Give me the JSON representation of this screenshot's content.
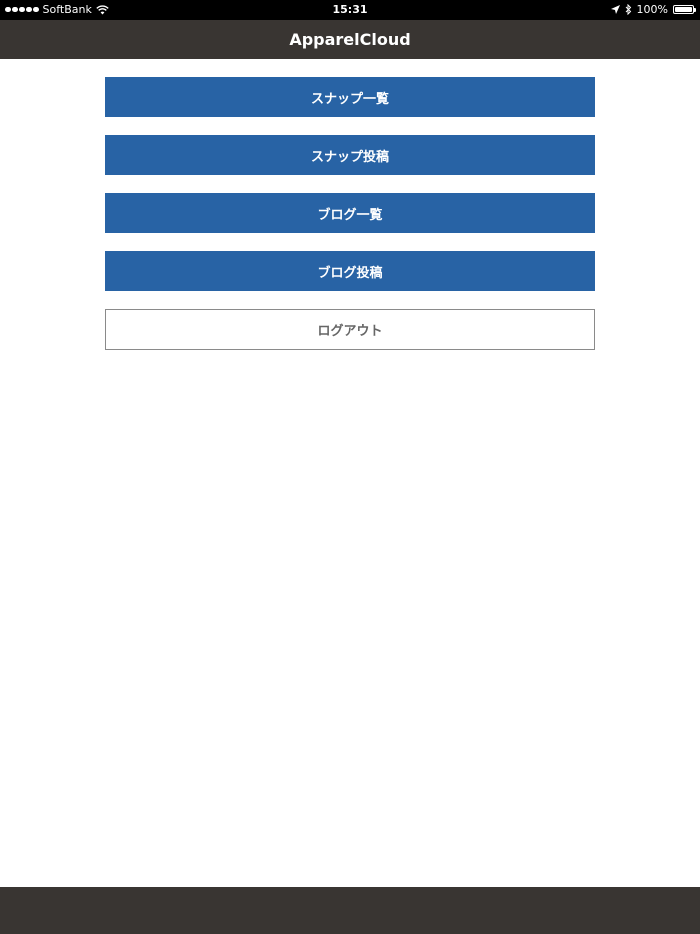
{
  "status_bar": {
    "carrier": "SoftBank",
    "time": "15:31",
    "battery_percent": "100%",
    "battery_level": 1.0,
    "icons": [
      "signal-dots-icon",
      "wifi-icon",
      "location-arrow-icon",
      "bluetooth-icon",
      "battery-icon"
    ]
  },
  "nav": {
    "title": "ApparelCloud"
  },
  "menu": {
    "snap_list": "スナップ一覧",
    "snap_post": "スナップ投稿",
    "blog_list": "ブログ一覧",
    "blog_post": "ブログ投稿",
    "logout": "ログアウト"
  },
  "colors": {
    "bar_background": "#393532",
    "primary_button": "#2863a5",
    "outline_border": "#8a8a8a",
    "outline_text": "#666666"
  }
}
